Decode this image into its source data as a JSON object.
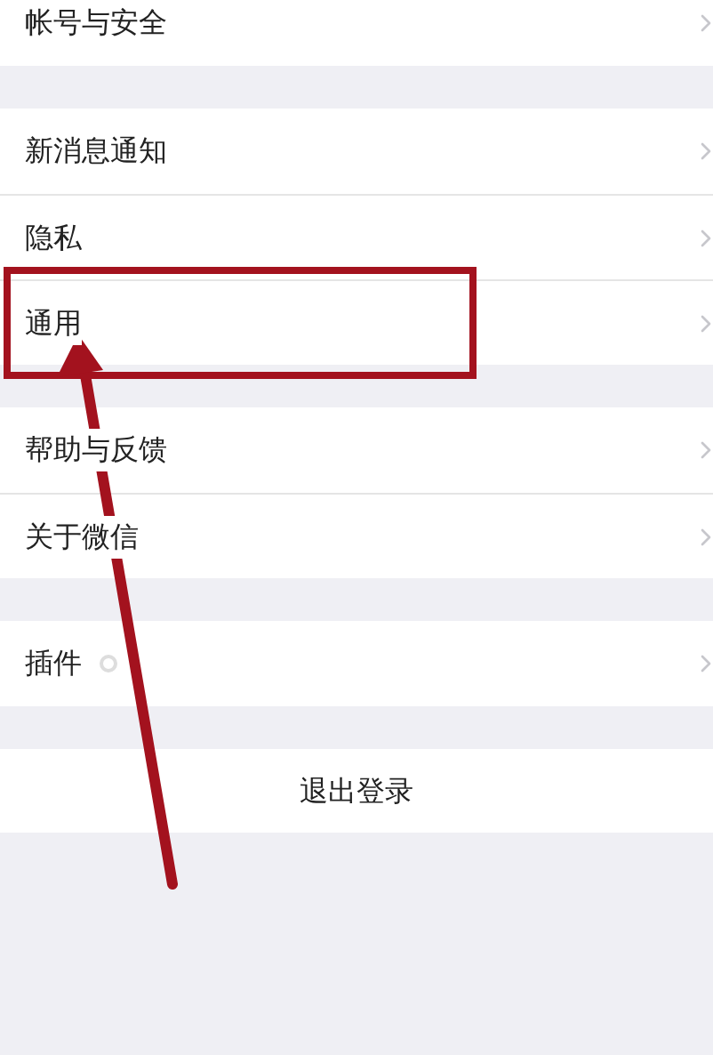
{
  "sections": [
    {
      "items": [
        {
          "label": "帐号与安全",
          "icon": false
        }
      ]
    },
    {
      "items": [
        {
          "label": "新消息通知",
          "icon": false
        },
        {
          "label": "隐私",
          "icon": false
        },
        {
          "label": "通用",
          "icon": false
        }
      ]
    },
    {
      "items": [
        {
          "label": "帮助与反馈",
          "icon": false
        },
        {
          "label": "关于微信",
          "icon": false
        }
      ]
    },
    {
      "items": [
        {
          "label": "插件",
          "icon": true
        }
      ]
    }
  ],
  "logout_button": "退出登录"
}
